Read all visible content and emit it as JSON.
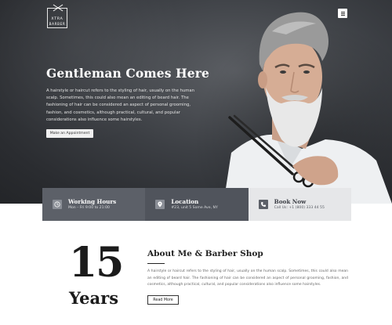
{
  "brand": {
    "logo_line1": "XTRA",
    "logo_line2": "BARBER"
  },
  "hero": {
    "title": "Gentleman Comes Here",
    "text": "A hairstyle or haircut refers to the styling of hair, usually on the human scalp. Sometimes, this could also mean an editing of beard hair. The fashioning of hair can be considered an aspect of personal grooming, fashion, and cosmetics, although practical, cultural, and popular considerations also influence some hairstyles.",
    "button_label": "Make an Appointment"
  },
  "info_bar": [
    {
      "icon": "clock-icon",
      "title": "Working Hours",
      "subtitle": "Mon – Fri 9:00 to 21:00"
    },
    {
      "icon": "location-pin-icon",
      "title": "Location",
      "subtitle": "#23, unit 5 Some Ave, NY"
    },
    {
      "icon": "phone-icon",
      "title": "Book Now",
      "subtitle": "Call Us: +1 (800) 333 44 55"
    }
  ],
  "about": {
    "years_number": "15",
    "years_label": "Years",
    "title": "About Me & Barber Shop",
    "text": "A hairstyle or haircut refers to the styling of hair, usually on the human scalp. Sometimes, this could also mean an editing of beard hair. The fashioning of hair can be considered an aspect of personal grooming, fashion, and cosmetics, although practical, cultural, and popular considerations also influence some hairstyles.",
    "button_label": "Read More"
  },
  "colors": {
    "hero_dark": "#3c3f44",
    "info_cell_1": "#5c6068",
    "info_cell_2": "#50545c",
    "info_cell_3": "#e6e7e9"
  }
}
